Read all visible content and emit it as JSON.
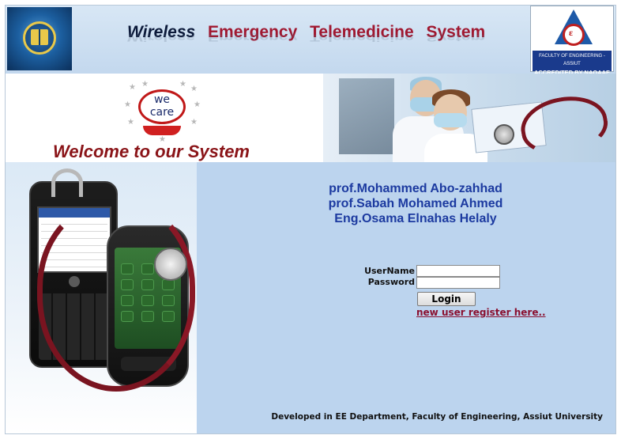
{
  "header": {
    "title_words": [
      "Wireless",
      "Emergency",
      "Telemedicine",
      "System"
    ],
    "faculty_logo": {
      "line1": "FACULTY OF ENGINEERING - ASSIUT",
      "line2": "ACCREDITED BY NAQAAE"
    }
  },
  "banner": {
    "wecare_line1": "we",
    "wecare_line2": "care",
    "welcome": "Welcome to our System"
  },
  "main": {
    "names": [
      "prof.Mohammed Abo-zahhad",
      "prof.Sabah Mohamed Ahmed",
      "Eng.Osama Elnahas Helaly"
    ],
    "login": {
      "username_label": "UserName",
      "password_label": "Password",
      "username_value": "",
      "password_value": "",
      "login_button": "Login",
      "register_link": "new user register here.."
    },
    "footer": "Developed in EE Department, Faculty of Engineering, Assiut University"
  },
  "colors": {
    "header_bg": "#c3d8ee",
    "title_navy": "#0c1a3a",
    "title_red": "#a01830",
    "welcome_red": "#8a1418",
    "names_blue": "#1c3aa0",
    "content_bg": "#bcd4ee",
    "link": "#8a1030"
  }
}
